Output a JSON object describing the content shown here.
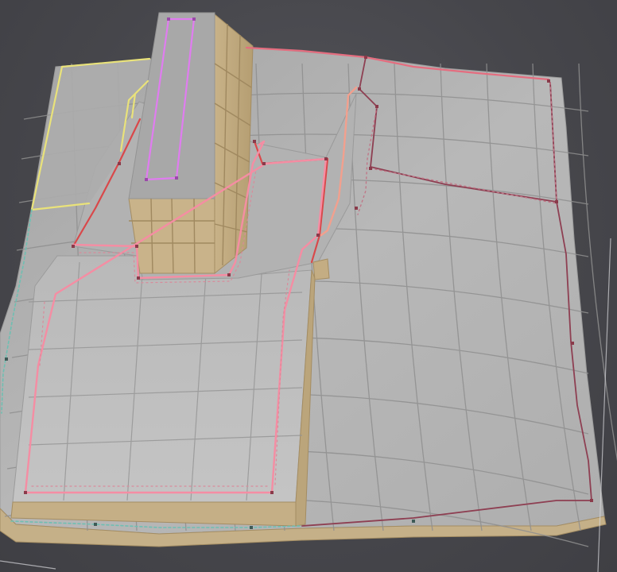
{
  "viewport": {
    "background": "#4a4a4f",
    "terrain_color": "#b4b4b4",
    "grid_color": "#8e8e8e",
    "building_top_color": "#a9a9a9",
    "building_side_color": "#c3ad84",
    "building_edge_color": "#a48d63",
    "footprint_colors": {
      "pink": "#f08ca0",
      "red": "#d9484a",
      "magenta": "#e07cf0",
      "yellow": "#e9e27a",
      "maroon": "#8a3a4a",
      "teal": "#56b3a6"
    }
  }
}
